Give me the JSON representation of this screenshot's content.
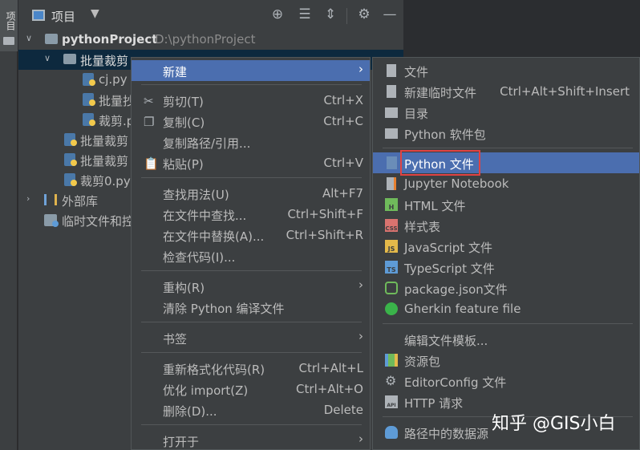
{
  "left_strip": {
    "tab_label": "项目"
  },
  "panel": {
    "title": "项目",
    "tools": [
      "target-icon",
      "expand-all-icon",
      "collapse-all-icon",
      "gear-icon",
      "minimize-icon"
    ]
  },
  "tree": {
    "root": {
      "name": "pythonProject",
      "path": "D:\\pythonProject"
    },
    "folder": {
      "name": "批量裁剪"
    },
    "files_in_folder": [
      "cj.py",
      "批量抄",
      "裁剪.p"
    ],
    "root_files": [
      "批量裁剪",
      "批量裁剪",
      "裁剪0.py"
    ],
    "external_libs": "外部库",
    "scratches": "临时文件和控"
  },
  "context_menu": {
    "items": [
      {
        "label": "新建",
        "shortcut": "",
        "submenu": true,
        "icon": "",
        "highlighted": true
      },
      {
        "label": "剪切(T)",
        "shortcut": "Ctrl+X",
        "icon": "scissors-icon"
      },
      {
        "label": "复制(C)",
        "shortcut": "Ctrl+C",
        "icon": "copy-icon"
      },
      {
        "label": "复制路径/引用...",
        "shortcut": "",
        "icon": ""
      },
      {
        "label": "粘贴(P)",
        "shortcut": "Ctrl+V",
        "icon": "paste-icon"
      },
      {
        "label": "查找用法(U)",
        "shortcut": "Alt+F7",
        "icon": ""
      },
      {
        "label": "在文件中查找...",
        "shortcut": "Ctrl+Shift+F",
        "icon": ""
      },
      {
        "label": "在文件中替换(A)...",
        "shortcut": "Ctrl+Shift+R",
        "icon": ""
      },
      {
        "label": "检查代码(I)...",
        "shortcut": "",
        "icon": ""
      },
      {
        "label": "重构(R)",
        "shortcut": "",
        "submenu": true,
        "icon": ""
      },
      {
        "label": "清除 Python 编译文件",
        "shortcut": "",
        "icon": ""
      },
      {
        "label": "书签",
        "shortcut": "",
        "submenu": true,
        "icon": ""
      },
      {
        "label": "重新格式化代码(R)",
        "shortcut": "Ctrl+Alt+L",
        "icon": ""
      },
      {
        "label": "优化 import(Z)",
        "shortcut": "Ctrl+Alt+O",
        "icon": ""
      },
      {
        "label": "删除(D)...",
        "shortcut": "Delete",
        "icon": ""
      },
      {
        "label": "打开于",
        "shortcut": "",
        "submenu": true,
        "icon": ""
      }
    ]
  },
  "new_submenu": {
    "items": [
      {
        "label": "文件",
        "shortcut": "",
        "icon": "file-icon"
      },
      {
        "label": "新建临时文件",
        "shortcut": "Ctrl+Alt+Shift+Insert",
        "icon": "scratch-file-icon"
      },
      {
        "label": "目录",
        "shortcut": "",
        "icon": "folder-icon"
      },
      {
        "label": "Python 软件包",
        "shortcut": "",
        "icon": "package-icon"
      },
      {
        "label": "Python 文件",
        "shortcut": "",
        "icon": "python-file-icon",
        "highlighted": true
      },
      {
        "label": "Jupyter Notebook",
        "shortcut": "",
        "icon": "jupyter-icon"
      },
      {
        "label": "HTML 文件",
        "shortcut": "",
        "icon": "html-file-icon",
        "badge": "H"
      },
      {
        "label": "样式表",
        "shortcut": "",
        "icon": "css-file-icon",
        "badge": "CSS"
      },
      {
        "label": "JavaScript 文件",
        "shortcut": "",
        "icon": "js-file-icon",
        "badge": "JS"
      },
      {
        "label": "TypeScript 文件",
        "shortcut": "",
        "icon": "ts-file-icon",
        "badge": "TS"
      },
      {
        "label": "package.json文件",
        "shortcut": "",
        "icon": "nodejs-icon"
      },
      {
        "label": "Gherkin feature file",
        "shortcut": "",
        "icon": "gherkin-icon"
      },
      {
        "label": "编辑文件模板...",
        "shortcut": "",
        "icon": ""
      },
      {
        "label": "资源包",
        "shortcut": "",
        "icon": "resource-bundle-icon"
      },
      {
        "label": "EditorConfig 文件",
        "shortcut": "",
        "icon": "editorconfig-icon"
      },
      {
        "label": "HTTP 请求",
        "shortcut": "",
        "icon": "http-request-icon",
        "badge": "API"
      },
      {
        "label": "路径中的数据源",
        "shortcut": "",
        "icon": "database-icon"
      }
    ]
  },
  "watermark": "知乎 @GIS小白",
  "colors": {
    "highlight": "#4b6eaf",
    "selection": "#0d293e",
    "annotation_box": "#e04343"
  }
}
